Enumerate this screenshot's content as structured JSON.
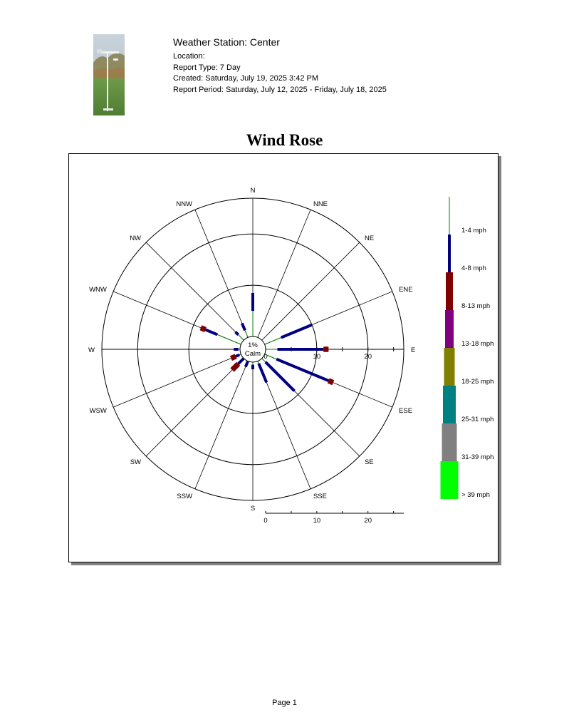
{
  "header": {
    "station": "Weather Station: Center",
    "location": "Location:",
    "report_type": "Report Type: 7 Day",
    "created": "Created: Saturday, July 19, 2025 3:42 PM",
    "period": "Report Period: Saturday, July 12, 2025 - Friday, July 18, 2025"
  },
  "footer": {
    "page": "Page 1"
  },
  "chart_data": {
    "type": "wind-rose",
    "title": "Wind Rose",
    "calm": {
      "percent_label": "1%",
      "label": "Calm"
    },
    "directions": [
      "N",
      "NNE",
      "NE",
      "ENE",
      "E",
      "ESE",
      "SE",
      "SSE",
      "S",
      "SSW",
      "SW",
      "WSW",
      "W",
      "WNW",
      "NW",
      "NNW"
    ],
    "radial_ticks": [
      "0",
      "10",
      "20"
    ],
    "scale_ticks": [
      "0",
      "10",
      "20"
    ],
    "rmax": 27,
    "speed_bins": [
      "1-4 mph",
      "4-8 mph",
      "8-13 mph",
      "13-18 mph",
      "18-25 mph",
      "25-31 mph",
      "31-39 mph",
      "> 39 mph"
    ],
    "bin_colors": [
      "#008000",
      "#000080",
      "#800000",
      "#800080",
      "#808000",
      "#008080",
      "#808080",
      "#00ff00"
    ],
    "series": [
      {
        "direction": "N",
        "values": [
          5,
          3.5,
          0
        ]
      },
      {
        "direction": "NNE",
        "values": [
          0.5,
          0,
          0
        ]
      },
      {
        "direction": "NE",
        "values": [
          0.5,
          0,
          0
        ]
      },
      {
        "direction": "ENE",
        "values": [
          3.5,
          6.5,
          0
        ]
      },
      {
        "direction": "E",
        "values": [
          2.3,
          9,
          1
        ]
      },
      {
        "direction": "ESE",
        "values": [
          2.5,
          11,
          1
        ]
      },
      {
        "direction": "SE",
        "values": [
          1,
          8,
          0
        ]
      },
      {
        "direction": "SSE",
        "values": [
          0.5,
          4,
          0
        ]
      },
      {
        "direction": "S",
        "values": [
          0.5,
          0.9,
          0
        ]
      },
      {
        "direction": "SSW",
        "values": [
          0,
          1.2,
          0
        ]
      },
      {
        "direction": "SW",
        "values": [
          0,
          1.5,
          1.7
        ]
      },
      {
        "direction": "WSW",
        "values": [
          0.3,
          0.8,
          1
        ]
      },
      {
        "direction": "W",
        "values": [
          0.3,
          0.9,
          0
        ]
      },
      {
        "direction": "WNW",
        "values": [
          5,
          2.5,
          1
        ]
      },
      {
        "direction": "NW",
        "values": [
          1.5,
          0.8,
          0
        ]
      },
      {
        "direction": "NNW",
        "values": [
          1.5,
          1.5,
          0
        ]
      }
    ]
  }
}
